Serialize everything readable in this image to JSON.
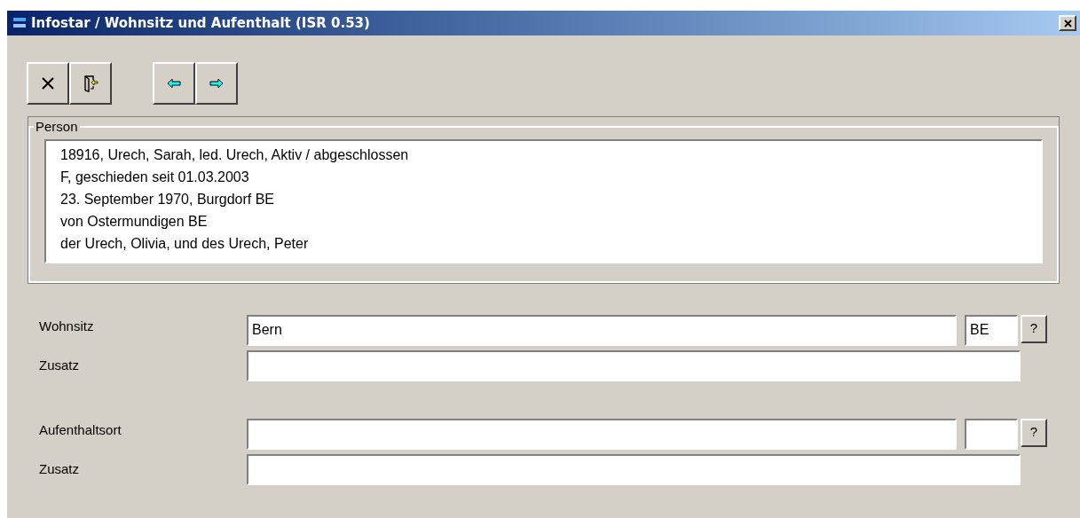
{
  "window": {
    "title": "Infostar / Wohnsitz und Aufenthalt (ISR 0.53)"
  },
  "person": {
    "legend": "Person",
    "lines": [
      "18916, Urech, Sarah, led. Urech, Aktiv / abgeschlossen",
      "F, geschieden seit 01.03.2003",
      "23. September 1970, Burgdorf BE",
      "von Ostermundigen BE",
      "der Urech, Olivia, und des Urech, Peter"
    ]
  },
  "fields": [
    {
      "kind": "place",
      "label": "Wohnsitz",
      "value": "Bern",
      "canton": "BE",
      "help": "?"
    },
    {
      "kind": "plain",
      "label": "Zusatz"
    },
    {
      "kind": "gap"
    },
    {
      "kind": "place",
      "label": "Aufenthaltsort",
      "help": "?"
    },
    {
      "kind": "plain",
      "label": "Zusatz"
    }
  ]
}
